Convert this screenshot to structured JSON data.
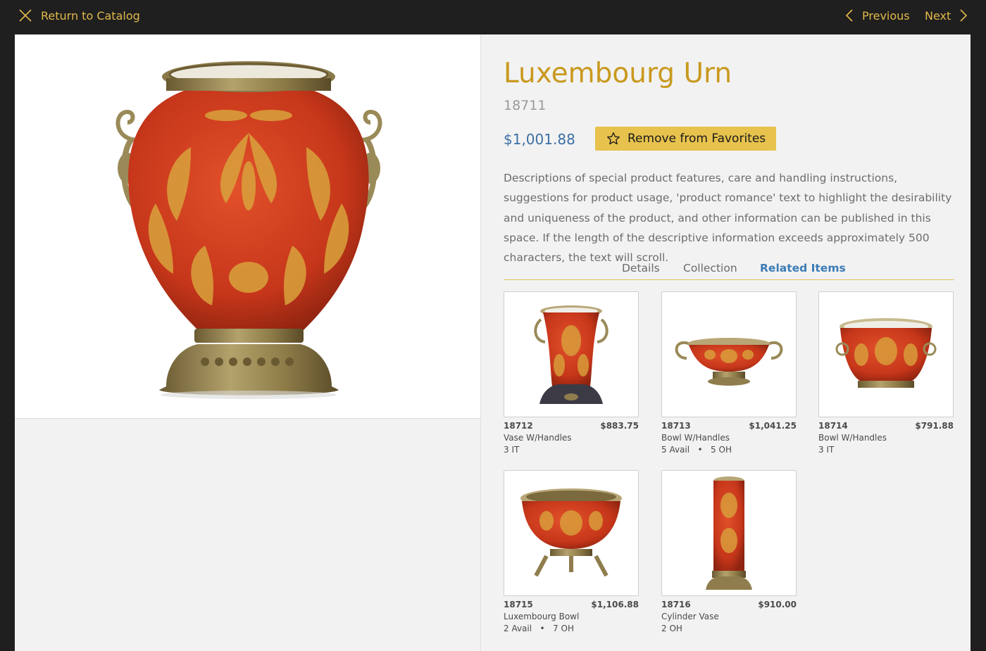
{
  "topbar": {
    "return_label": "Return to Catalog",
    "previous_label": "Previous",
    "next_label": "Next",
    "accent_color": "#e2b94a"
  },
  "product": {
    "title": "Luxembourg Urn",
    "sku": "18711",
    "price": "$1,001.88",
    "favorite_button_label": "Remove from Favorites",
    "description": "Descriptions of special product features, care and handling instructions, suggestions for product usage, 'product romance' text to highlight the desirability and uniqueness of the product, and other information can be published in this space. If the length of the descriptive information exceeds approximately 500 characters, the text will scroll."
  },
  "tabs": [
    {
      "label": "Details",
      "active": false
    },
    {
      "label": "Collection",
      "active": false
    },
    {
      "label": "Related Items",
      "active": true
    }
  ],
  "related_items": [
    {
      "sku": "18712",
      "price": "$883.75",
      "name": "Vase W/Handles",
      "stock": "3 IT",
      "image": "tall-vase-handles"
    },
    {
      "sku": "18713",
      "price": "$1,041.25",
      "name": "Bowl W/Handles",
      "stock": "5 Avail   •   5 OH",
      "image": "shallow-bowl-handles"
    },
    {
      "sku": "18714",
      "price": "$791.88",
      "name": "Bowl W/Handles",
      "stock": "3 IT",
      "image": "deep-bowl-handles"
    },
    {
      "sku": "18715",
      "price": "$1,106.88",
      "name": "Luxembourg Bowl",
      "stock": "2 Avail   •   7 OH",
      "image": "footed-bowl"
    },
    {
      "sku": "18716",
      "price": "$910.00",
      "name": "Cylinder Vase",
      "stock": "2 OH",
      "image": "cylinder-vase"
    }
  ],
  "icons": {
    "close": "close-icon",
    "previous": "chevron-left-icon",
    "next": "chevron-right-icon",
    "favorite": "star-outline-icon"
  },
  "colors": {
    "title_gold": "#c9991f",
    "price_blue": "#3c6fa3",
    "button_gold": "#e7c24d",
    "urn_red": "#c93a1c",
    "urn_gold": "#d9a23c",
    "bronze": "#8f7d4d"
  }
}
